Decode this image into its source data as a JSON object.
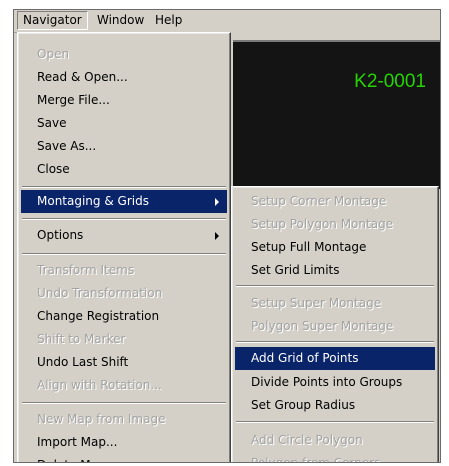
{
  "menubar": {
    "items": [
      "Navigator",
      "Window",
      "Help"
    ]
  },
  "panel": {
    "label": "K2-0001",
    "label_color": "#25d400"
  },
  "navigator_menu": {
    "items": [
      {
        "label": "Open",
        "enabled": false
      },
      {
        "label": "Read & Open...",
        "enabled": true
      },
      {
        "label": "Merge File...",
        "enabled": true
      },
      {
        "label": "Save",
        "enabled": true
      },
      {
        "label": "Save As...",
        "enabled": true
      },
      {
        "label": "Close",
        "enabled": true
      },
      {
        "label": "Montaging & Grids",
        "enabled": true,
        "submenu": true,
        "highlighted": true
      },
      {
        "label": "Options",
        "enabled": true,
        "submenu": true
      },
      {
        "label": "Transform Items",
        "enabled": false
      },
      {
        "label": "Undo Transformation",
        "enabled": false
      },
      {
        "label": "Change Registration",
        "enabled": true
      },
      {
        "label": "Shift to Marker",
        "enabled": false
      },
      {
        "label": "Undo Last Shift",
        "enabled": true
      },
      {
        "label": "Align with Rotation...",
        "enabled": false
      },
      {
        "label": "New Map from Image",
        "enabled": false
      },
      {
        "label": "Import Map...",
        "enabled": true
      },
      {
        "label": "Delete Map",
        "enabled": true
      }
    ]
  },
  "montage_submenu": {
    "items": [
      {
        "label": "Setup Corner Montage",
        "enabled": false
      },
      {
        "label": "Setup Polygon Montage",
        "enabled": false
      },
      {
        "label": "Setup Full Montage",
        "enabled": true
      },
      {
        "label": "Set Grid Limits",
        "enabled": true
      },
      {
        "label": "Setup Super Montage",
        "enabled": false
      },
      {
        "label": "Polygon Super Montage",
        "enabled": false
      },
      {
        "label": "Add Grid of Points",
        "enabled": true,
        "highlighted": true
      },
      {
        "label": "Divide Points into Groups",
        "enabled": true
      },
      {
        "label": "Set Group Radius",
        "enabled": true
      },
      {
        "label": "Add Circle Polygon",
        "enabled": false
      },
      {
        "label": "Polygon from Corners",
        "enabled": false
      }
    ]
  },
  "colors": {
    "menu_bg": "#d4d0c8",
    "highlight": "#0a246a",
    "disabled_text": "#a3a3a3"
  }
}
